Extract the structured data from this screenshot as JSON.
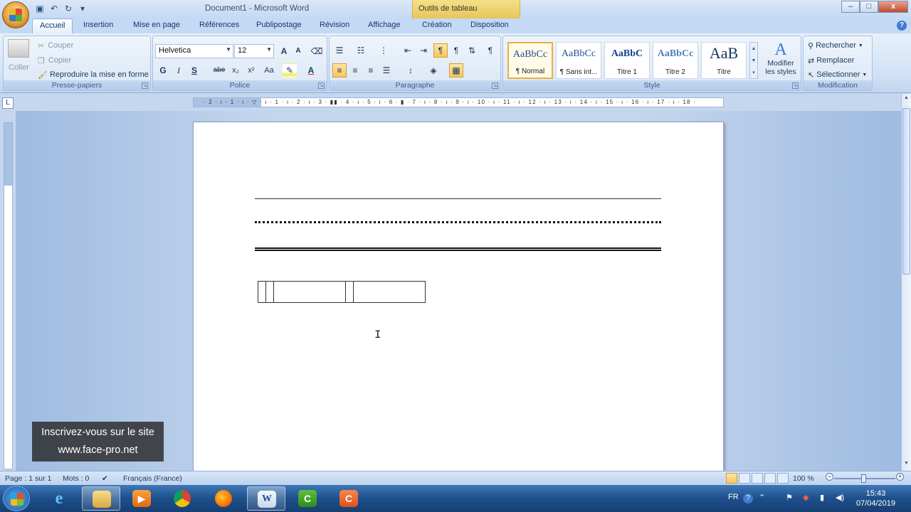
{
  "window": {
    "title": "Document1 - Microsoft Word",
    "context_tab_header": "Outils de tableau",
    "minimize": "–",
    "maximize": "□",
    "close": "x"
  },
  "tabs": [
    {
      "label": "Accueil",
      "active": true
    },
    {
      "label": "Insertion"
    },
    {
      "label": "Mise en page"
    },
    {
      "label": "Références"
    },
    {
      "label": "Publipostage"
    },
    {
      "label": "Révision"
    },
    {
      "label": "Affichage"
    },
    {
      "label": "Création"
    },
    {
      "label": "Disposition"
    }
  ],
  "ribbon": {
    "clipboard": {
      "label": "Presse-papiers",
      "paste": "Coller",
      "cut": "Couper",
      "copy": "Copier",
      "format_painter": "Reproduire la mise en forme"
    },
    "font": {
      "label": "Police",
      "font_name": "Helvetica",
      "font_size": "12",
      "bold": "G",
      "italic": "I",
      "underline": "S",
      "strikethrough": "abe",
      "subscript": "x₂",
      "superscript": "x²",
      "change_case": "Aa",
      "grow": "A",
      "shrink": "A",
      "font_color": "A"
    },
    "paragraph": {
      "label": "Paragraphe",
      "show_marks": "¶"
    },
    "styles": {
      "label": "Style",
      "items": [
        {
          "sample": "AaBbCc",
          "name": "¶ Normal",
          "selected": true
        },
        {
          "sample": "AaBbCc",
          "name": "¶ Sans int..."
        },
        {
          "sample": "AaBbC",
          "name": "Titre 1"
        },
        {
          "sample": "AaBbCc",
          "name": "Titre 2"
        },
        {
          "sample": "AaB",
          "name": "Titre"
        }
      ],
      "modify_line1": "Modifier",
      "modify_line2": "les styles"
    },
    "editing": {
      "label": "Modification",
      "find": "Rechercher",
      "replace": "Remplacer",
      "select": "Sélectionner"
    }
  },
  "ruler": {
    "ticks": "· 2 · ı · 1 · ı · ▽ · ı · 1 · ı · 2 · ı · 3 · ▮▮ · 4 · ı · 5 · ı · 6 · ▮ · 7 · ı · 8 · ı · 9 · ı · 10 · ı · 11 · ı · 12 · ı · 13 · ı · 14 · ı · 15 · ı · 16 · ı · 17 · ı · 18 ·"
  },
  "overlay": {
    "line1": "Inscrivez-vous sur le site",
    "line2": "www.face-pro.net"
  },
  "statusbar": {
    "page": "Page : 1 sur 1",
    "words": "Mots : 0",
    "language": "Français (France)",
    "zoom": "100 %"
  },
  "taskbar": {
    "language": "FR",
    "time": "15:43",
    "date": "07/04/2019"
  }
}
